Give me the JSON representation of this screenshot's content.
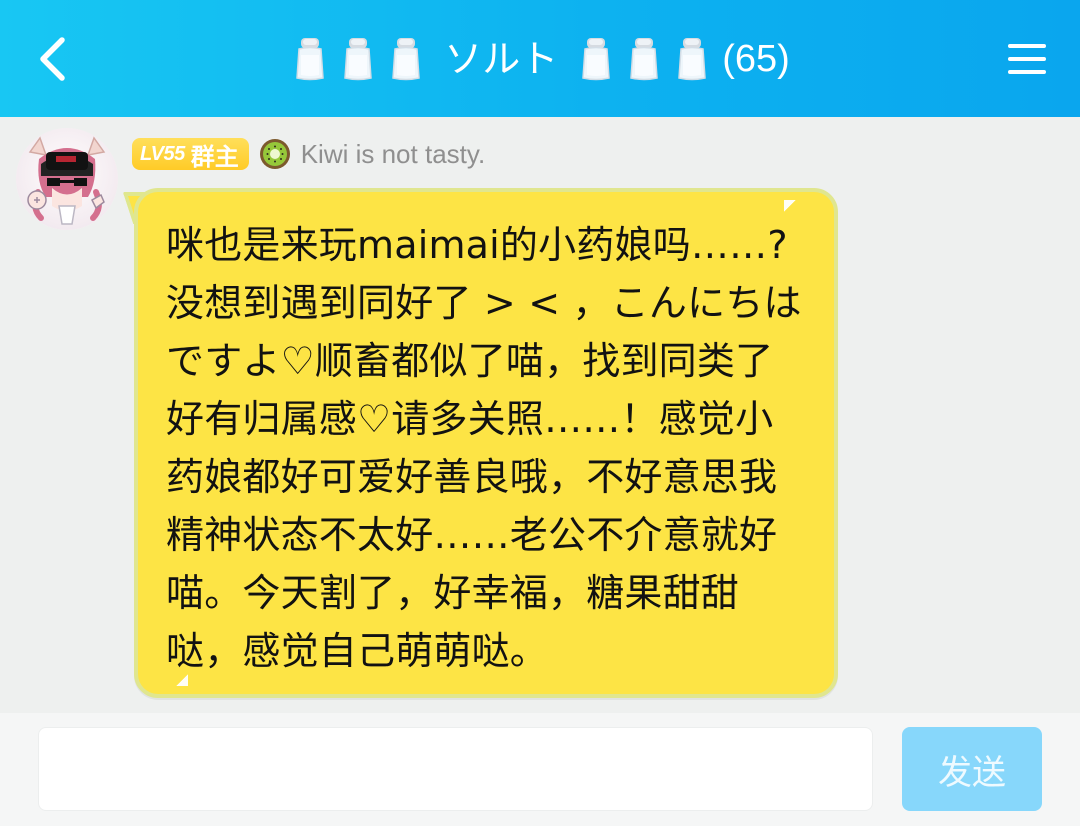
{
  "header": {
    "back_icon": "back-arrow-icon",
    "title": "ソルト",
    "salt_icon": "salt-shaker-icon",
    "member_count": "(65)",
    "menu_icon": "menu-icon"
  },
  "post": {
    "level": "LV55",
    "role": "群主",
    "kiwi_icon": "kiwi-icon",
    "nickname": "Kiwi is not tasty.",
    "message": "咪也是来玩maimai的小药娘吗……?\n没想到遇到同好了 > < ，こんにちは\nですよ♡顺畜都似了喵，找到同类了\n好有归属感♡请多关照……！感觉小\n药娘都好可爱好善良哦，不好意思我\n精神状态不太好……老公不介意就好\n喵。今天割了，好幸福，糖果甜甜\n哒，感觉自己萌萌哒。"
  },
  "composer": {
    "send_label": "发送",
    "input_value": "",
    "placeholder": ""
  },
  "colors": {
    "header": "#10b8f1",
    "bubble": "#fde445",
    "badge": "#ffcf34",
    "send_button": "#87d7fb"
  }
}
